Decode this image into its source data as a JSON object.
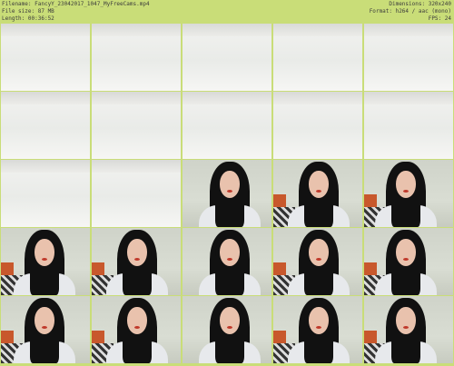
{
  "header": {
    "filename": "Filename: FancyY_23042017_1047_MyFreeCams.mp4",
    "filesize": "File size: 87 MB",
    "length": "Length: 00:36:52",
    "dimensions": "Dimensions: 320x240",
    "format": "Format: h264 / aac (mono)",
    "fps": "FPS: 24"
  },
  "thumbnails": [
    {
      "scene": "wall"
    },
    {
      "scene": "wall"
    },
    {
      "scene": "wall"
    },
    {
      "scene": "wall"
    },
    {
      "scene": "wall"
    },
    {
      "scene": "wall"
    },
    {
      "scene": "wall"
    },
    {
      "scene": "wall"
    },
    {
      "scene": "wall"
    },
    {
      "scene": "wall"
    },
    {
      "scene": "wall"
    },
    {
      "scene": "wall"
    },
    {
      "scene": "person"
    },
    {
      "scene": "person"
    },
    {
      "scene": "person"
    },
    {
      "scene": "person"
    },
    {
      "scene": "person"
    },
    {
      "scene": "person"
    },
    {
      "scene": "person"
    },
    {
      "scene": "person"
    },
    {
      "scene": "person"
    },
    {
      "scene": "person"
    },
    {
      "scene": "person"
    },
    {
      "scene": "person"
    },
    {
      "scene": "person"
    }
  ]
}
